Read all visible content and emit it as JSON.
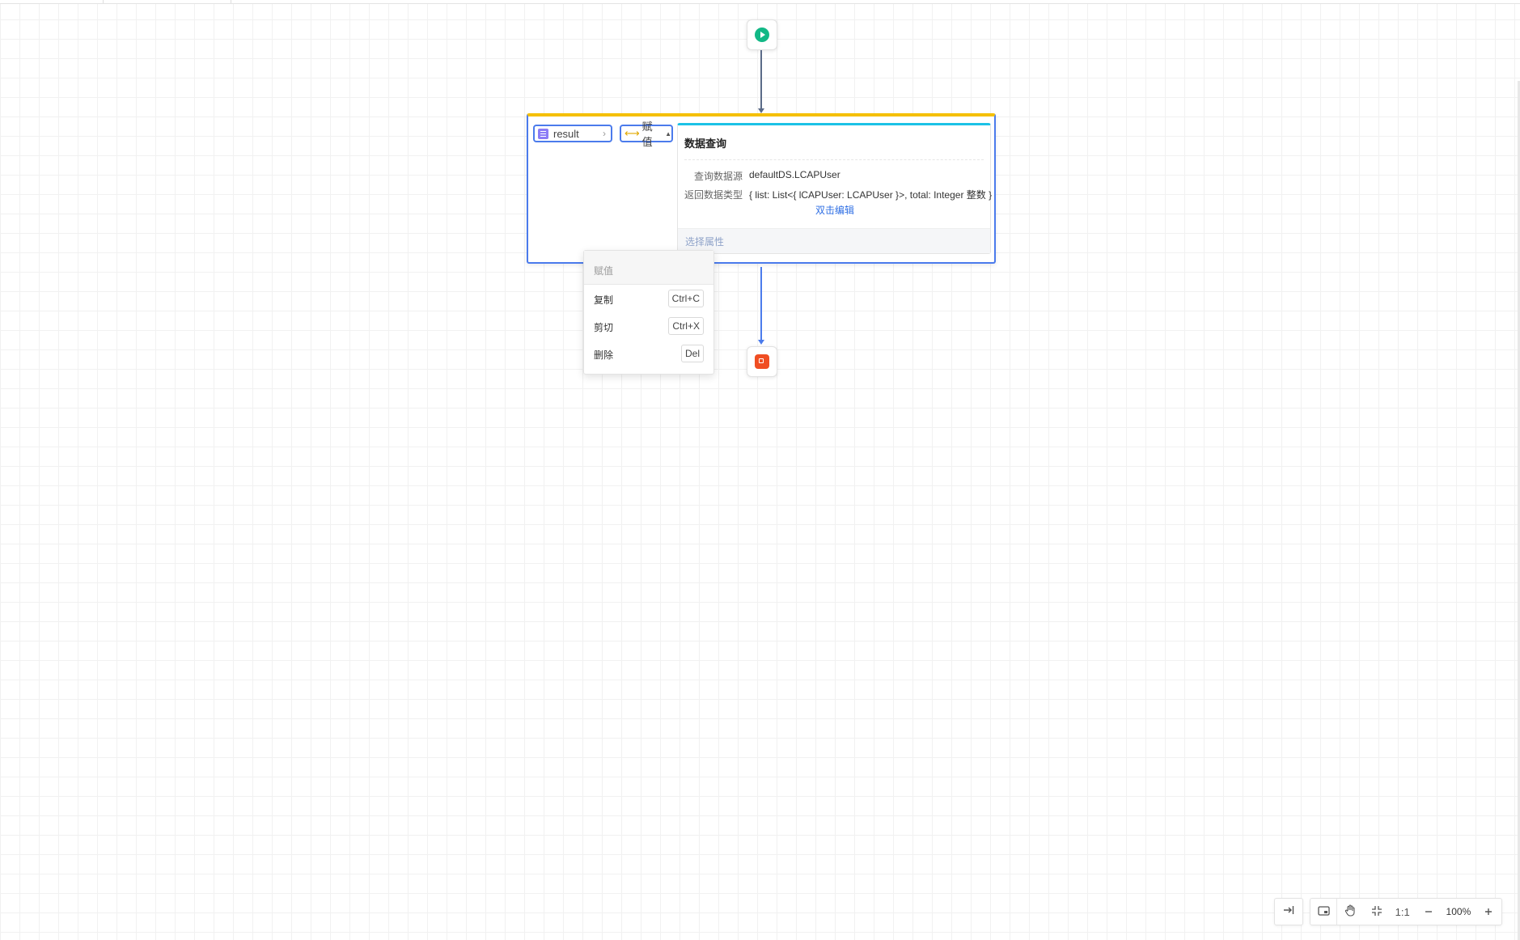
{
  "assign_node": {
    "left_var": "result",
    "operator_label": "赋值"
  },
  "query_card": {
    "title": "数据查询",
    "datasource_label": "查询数据源",
    "datasource_value": "defaultDS.LCAPUser",
    "return_label": "返回数据类型",
    "return_value": "{ list: List<{ lCAPUser: LCAPUser }>, total: Integer 整数 }",
    "edit_link": "双击编辑",
    "select_attr_link": "选择属性"
  },
  "context_menu": {
    "header": "赋值",
    "items": [
      {
        "label": "复制",
        "shortcut": "Ctrl+C"
      },
      {
        "label": "剪切",
        "shortcut": "Ctrl+X"
      },
      {
        "label": "删除",
        "shortcut": "Del"
      }
    ]
  },
  "toolbar": {
    "ratio_label": "1:1",
    "zoom_value": "100%",
    "icons": [
      "collapse-panel-icon",
      "minimap-icon",
      "hand-icon",
      "fit-icon",
      "zoom-out-icon",
      "zoom-in-icon"
    ]
  },
  "colors": {
    "accent": "#4b7bec",
    "start": "#12b886",
    "end": "#f04e23",
    "assign_bar": "#f5c000",
    "query_bar": "#1cc2e6"
  }
}
